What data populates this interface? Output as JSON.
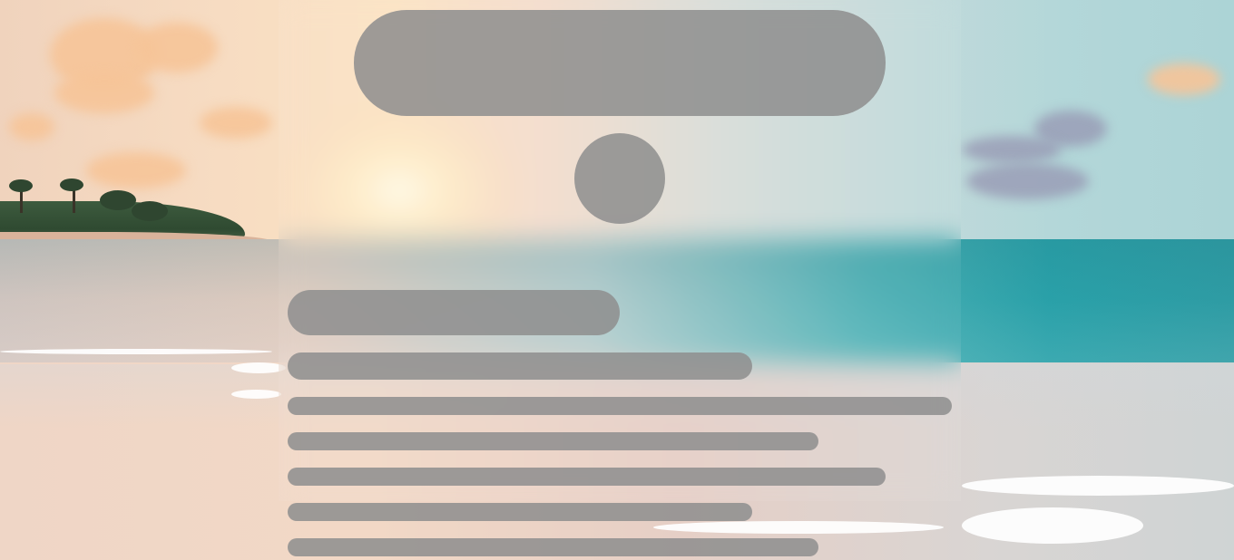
{
  "page": {
    "state": "loading-skeleton",
    "background": "beach-sunset-photo"
  },
  "colors": {
    "skeleton": "#8e8e8e",
    "sky_warm": "#f7dcc2",
    "sky_cool": "#acd4d6",
    "sea": "#2aa3ab",
    "sand": "#f2d8c6"
  },
  "skeleton": {
    "header_bar": "",
    "avatar": "",
    "title_line": "",
    "subtitle_line": "",
    "text_lines": [
      "",
      "",
      "",
      "",
      ""
    ]
  }
}
